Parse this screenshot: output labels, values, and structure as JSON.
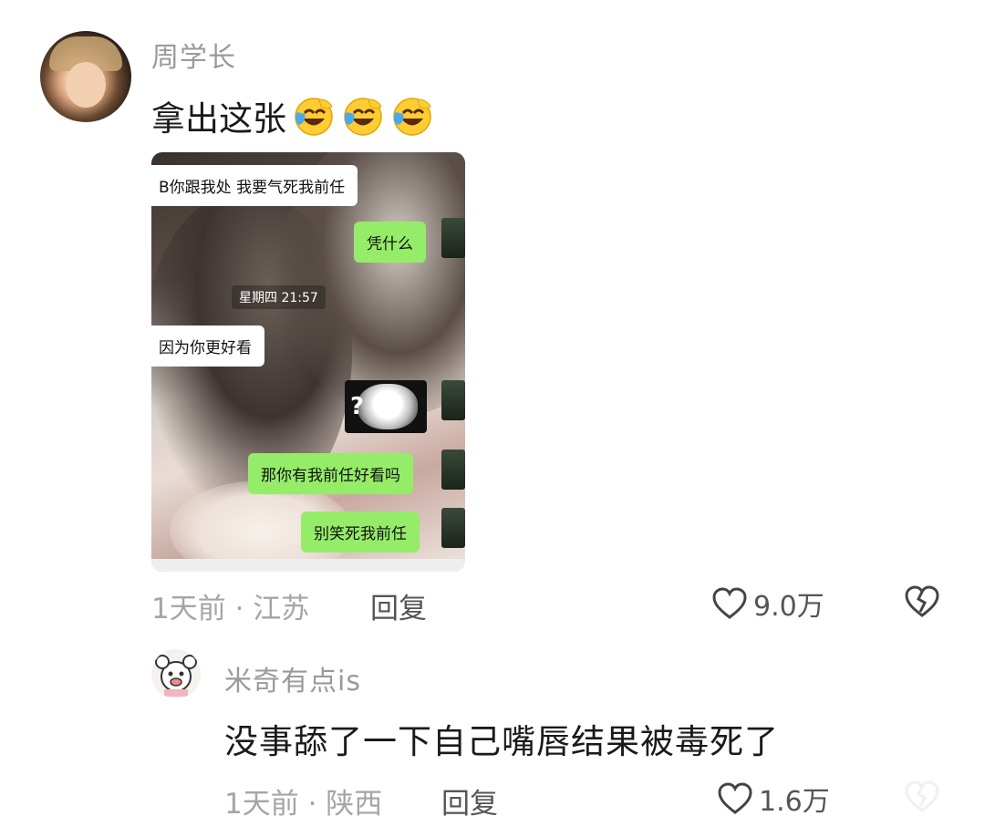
{
  "comments": [
    {
      "username": "周学长",
      "text": "拿出这张",
      "emoji_icon": "laughing-crying-emoji",
      "emoji_count": 3,
      "meta": "1天前 · 江苏",
      "reply_label": "回复",
      "like_count": "9.0万",
      "screenshot": {
        "messages": [
          {
            "side": "left",
            "text": "B你跟我处 我要气死我前任"
          },
          {
            "side": "right",
            "text": "凭什么"
          },
          {
            "side": "center",
            "text": "星期四 21:57"
          },
          {
            "side": "left",
            "text": "因为你更好看"
          },
          {
            "side": "right",
            "type": "sticker",
            "text": "?"
          },
          {
            "side": "right",
            "text": "那你有我前任好看吗"
          },
          {
            "side": "right",
            "text": "别笑死我前任"
          }
        ]
      }
    },
    {
      "username": "米奇有点is",
      "text": "没事舔了一下自己嘴唇结果被毒死了",
      "meta": "1天前 · 陕西",
      "reply_label": "回复",
      "like_count": "1.6万"
    }
  ],
  "colors": {
    "username": "#9a9a9a",
    "meta": "#a5a5a5",
    "green_bubble": "#95ec69"
  }
}
